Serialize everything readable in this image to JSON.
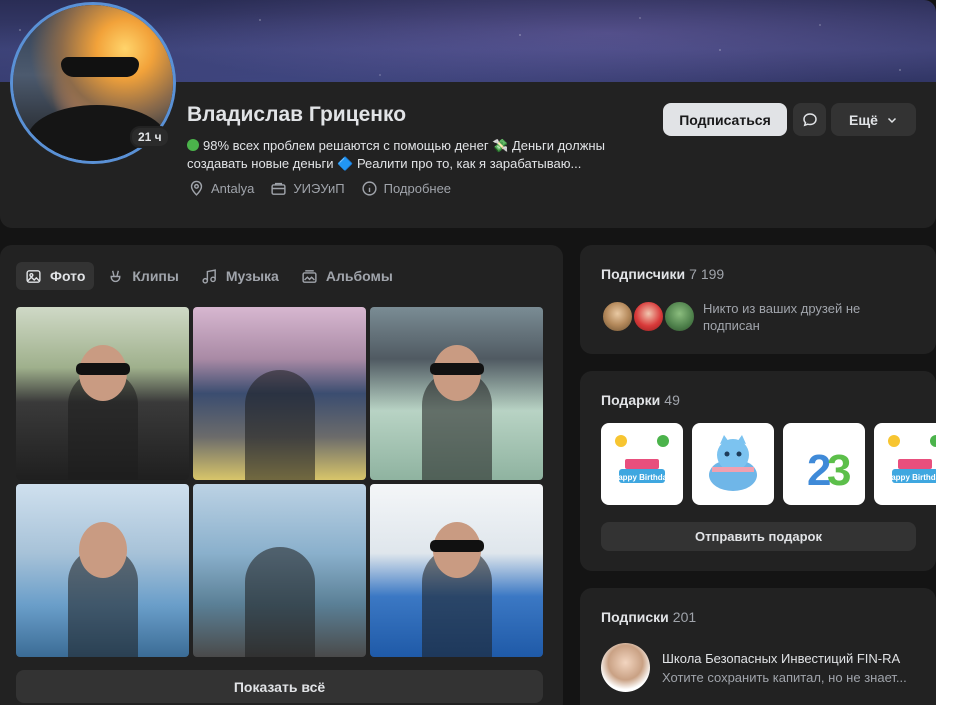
{
  "profile": {
    "name": "Владислав Гриценко",
    "online": "21 ч",
    "status_line1": "98% всех проблем решаются с помощью денег 💸 Деньги должны",
    "status_line2": "создавать новые деньги 🔷 Реалити про то, как я зарабатываю...",
    "meta": {
      "city": "Antalya",
      "work": "УИЭУиП",
      "more": "Подробнее"
    }
  },
  "actions": {
    "subscribe": "Подписаться",
    "more": "Ещё"
  },
  "photos": {
    "tabs": [
      {
        "label": "Фото",
        "icon": "image-icon",
        "active": true
      },
      {
        "label": "Клипы",
        "icon": "clips-icon",
        "active": false
      },
      {
        "label": "Музыка",
        "icon": "music-icon",
        "active": false
      },
      {
        "label": "Альбомы",
        "icon": "albums-icon",
        "active": false
      }
    ],
    "show_all": "Показать всё"
  },
  "followers": {
    "title": "Подписчики",
    "count": "7 199",
    "note": "Никто из ваших друзей не подписан"
  },
  "gifts": {
    "title": "Подарки",
    "count": "49",
    "items": [
      "Happy Birthday",
      "",
      "",
      "Happy Birthday"
    ],
    "send": "Отправить подарок"
  },
  "subscriptions": {
    "title": "Подписки",
    "count": "201",
    "items": [
      {
        "name": "Школа Безопасных Инвестиций FIN-RA",
        "desc": "Хотите сохранить капитал, но не знает..."
      }
    ]
  },
  "colors": {
    "background": "#141414",
    "card": "#222222",
    "button": "#333333",
    "text": "#e1e3e6",
    "muted": "#a0a4ab",
    "online_dot": "#4bb34b",
    "avatar_ring": "#5a91d6"
  }
}
